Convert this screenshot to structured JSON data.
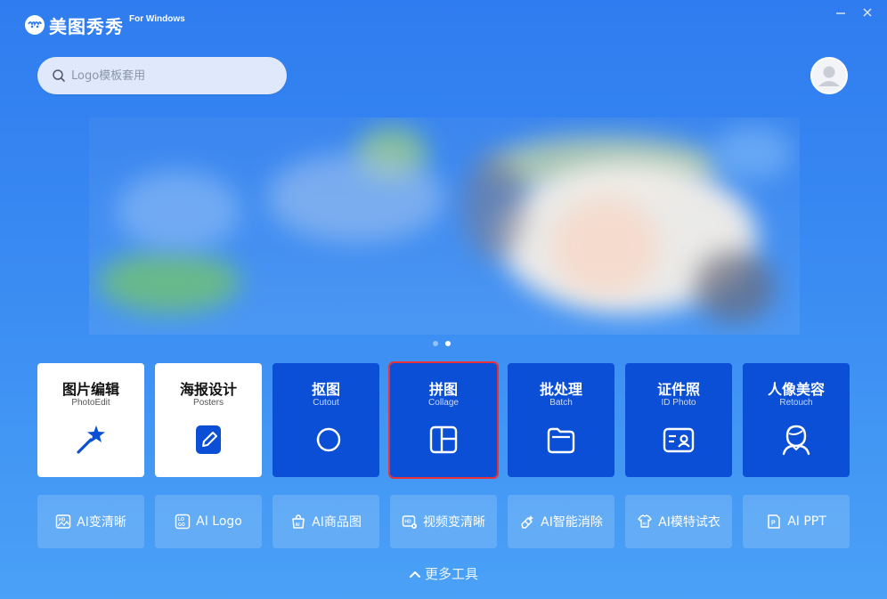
{
  "app": {
    "logo_text": "美图秀秀",
    "logo_sub": "For Windows"
  },
  "search": {
    "placeholder": "Logo模板套用",
    "value": ""
  },
  "banner": {
    "slides": 2,
    "active_slide": 2
  },
  "tools": [
    {
      "title": "图片编辑",
      "subtitle": "PhotoEdit",
      "icon": "magic-wand-icon"
    },
    {
      "title": "海报设计",
      "subtitle": "Posters",
      "icon": "poster-edit-icon"
    },
    {
      "title": "抠图",
      "subtitle": "Cutout",
      "icon": "cutout-icon"
    },
    {
      "title": "拼图",
      "subtitle": "Collage",
      "icon": "collage-icon"
    },
    {
      "title": "批处理",
      "subtitle": "Batch",
      "icon": "folder-icon"
    },
    {
      "title": "证件照",
      "subtitle": "ID Photo",
      "icon": "id-card-icon"
    },
    {
      "title": "人像美容",
      "subtitle": "Retouch",
      "icon": "portrait-icon"
    }
  ],
  "small_tools": [
    {
      "title": "AI变清晰",
      "icon": "hd-image-icon"
    },
    {
      "title": "AI Logo",
      "icon": "logo-icon"
    },
    {
      "title": "AI商品图",
      "icon": "product-bag-icon"
    },
    {
      "title": "视频变清晰",
      "icon": "hd-video-icon"
    },
    {
      "title": "AI智能消除",
      "icon": "eraser-icon"
    },
    {
      "title": "AI模特试衣",
      "icon": "model-outfit-icon"
    },
    {
      "title": "AI PPT",
      "icon": "ppt-icon"
    }
  ],
  "more": {
    "label": "更多工具"
  },
  "colors": {
    "card_blue": "#0a4fd6",
    "selected_outline": "#e8323a"
  }
}
